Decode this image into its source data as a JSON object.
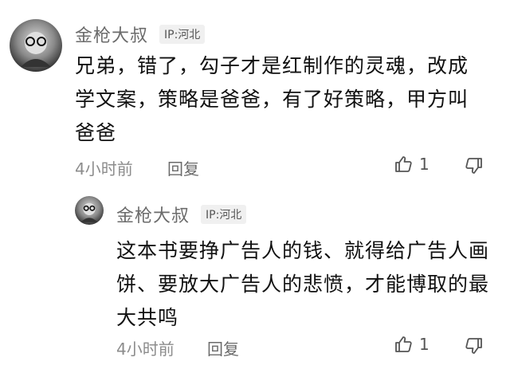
{
  "comment": {
    "username": "金枪大叔",
    "ip": "IP:河北",
    "text": "兄弟，错了，勾子才是红制作的灵魂，改成学文案，策略是爸爸，有了好策略，甲方叫爸爸",
    "time": "4小时前",
    "reply_label": "回复",
    "like_count": "1"
  },
  "reply": {
    "username": "金枪大叔",
    "ip": "IP:河北",
    "text": "这本书要挣广告人的钱、就得给广告人画饼、要放大广告人的悲愤，才能博取的最大共鸣",
    "time": "4小时前",
    "reply_label": "回复",
    "like_count": "1"
  },
  "icons": {
    "like": "thumbs-up-icon",
    "dislike": "thumbs-down-icon"
  }
}
